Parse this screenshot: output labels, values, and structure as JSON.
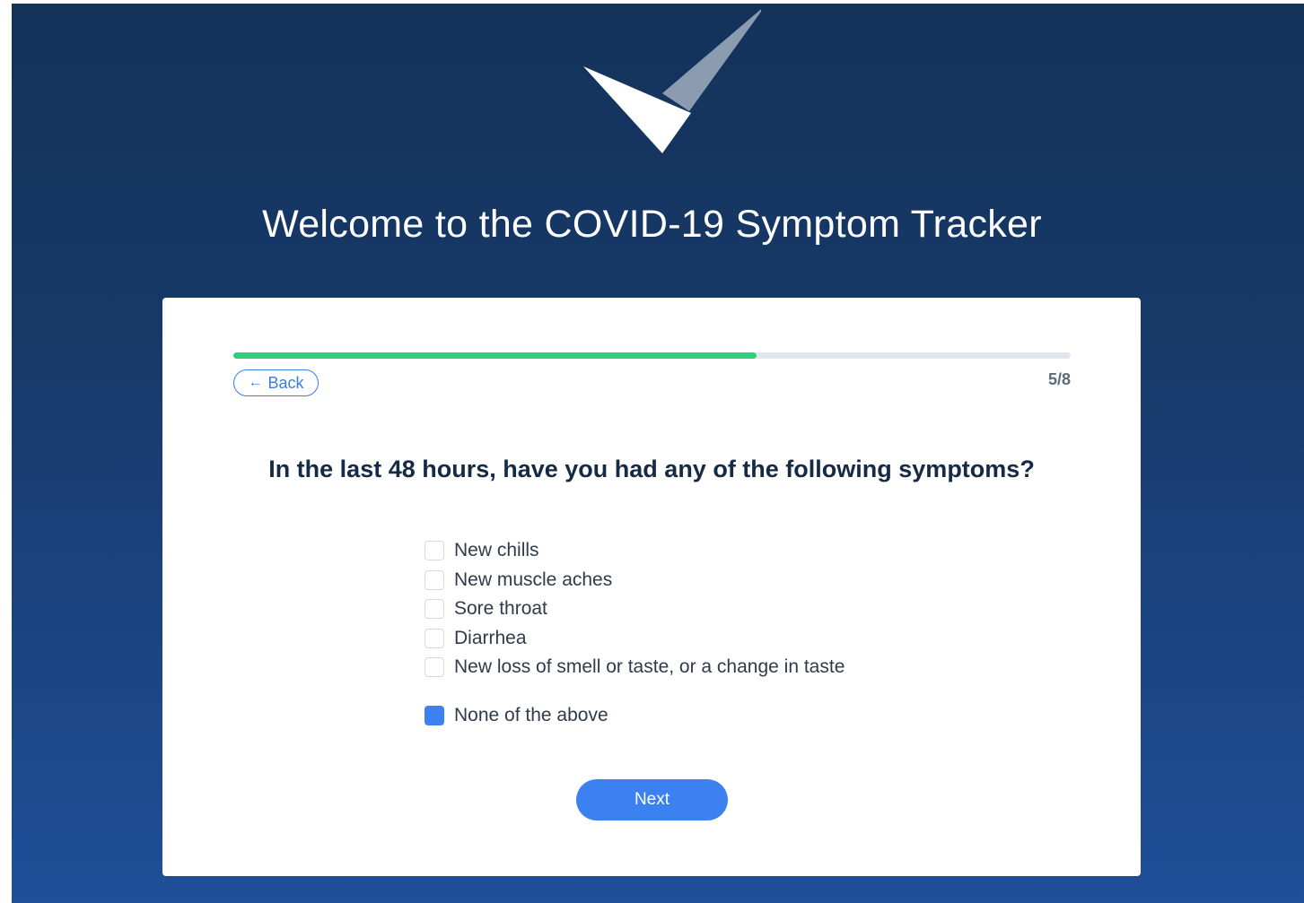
{
  "header": {
    "title": "Welcome to the COVID-19 Symptom Tracker",
    "logo_icon": "checkmark-logo-icon"
  },
  "progress": {
    "current_step": 5,
    "total_steps": 8,
    "label": "5/8",
    "fill_fraction": 0.625,
    "fill_color": "#2fcf7a"
  },
  "back_button": {
    "label": "Back",
    "icon": "arrow-left-icon"
  },
  "question": "In the last 48 hours, have you had any of the following symptoms?",
  "options": [
    {
      "label": "New chills",
      "checked": false
    },
    {
      "label": "New muscle aches",
      "checked": false
    },
    {
      "label": "Sore throat",
      "checked": false
    },
    {
      "label": "Diarrhea",
      "checked": false
    },
    {
      "label": "New loss of smell or taste, or a change in taste",
      "checked": false
    },
    {
      "label": "None of the above",
      "checked": true
    }
  ],
  "next_button": {
    "label": "Next"
  },
  "colors": {
    "accent": "#3b82f0",
    "heading": "#152a45",
    "background_top": "#14325a",
    "background_bottom": "#1e4f99"
  }
}
